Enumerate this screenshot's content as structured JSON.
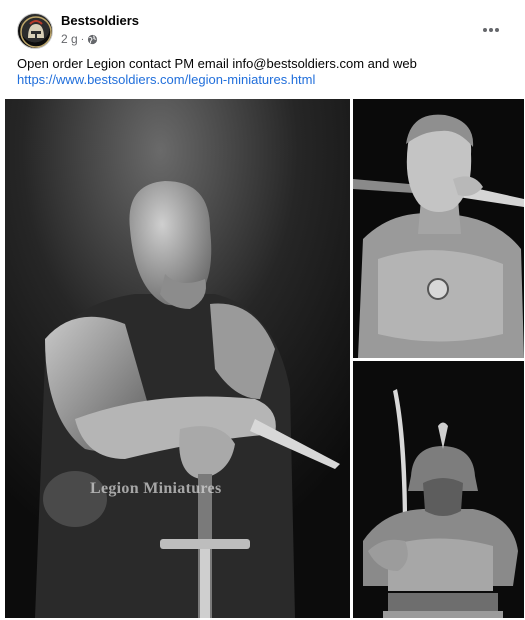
{
  "post": {
    "page_name": "Bestsoldiers",
    "time": "2 g",
    "audience_icon": "globe-icon",
    "text_line": "Open order Legion  contact PM email info@bestsoldiers.com  and web",
    "link": "https://www.bestsoldiers.com/legion-miniatures.html",
    "more_icon": "more-dots-icon"
  },
  "photos": [
    {
      "watermark": "Legion Miniatures"
    },
    {},
    {}
  ]
}
